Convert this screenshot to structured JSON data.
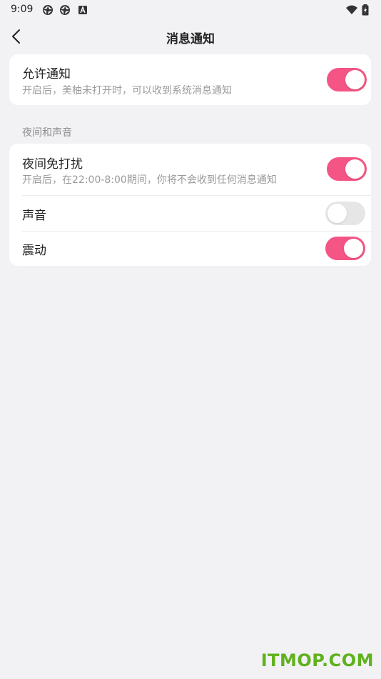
{
  "status_bar": {
    "time": "9:09",
    "icons": [
      "aperture-icon",
      "aperture-icon",
      "keyboard-a-icon",
      "wifi-icon",
      "battery-charging-icon"
    ]
  },
  "header": {
    "title": "消息通知",
    "back_icon": "chevron-left-icon"
  },
  "allow_notifications": {
    "title": "允许通知",
    "description": "开启后，美柚未打开时，可以收到系统消息通知",
    "enabled": true
  },
  "night_section": {
    "header": "夜间和声音",
    "items": [
      {
        "title": "夜间免打扰",
        "description": "开启后，在22:00-8:00期间，你将不会收到任何消息通知",
        "enabled": true
      },
      {
        "title": "声音",
        "enabled": false
      },
      {
        "title": "震动",
        "enabled": true
      }
    ]
  },
  "colors": {
    "accent": "#f45584",
    "background": "#f2f2f5",
    "card": "#ffffff",
    "toggle_off": "#e6e6e6"
  },
  "watermark": "ITMOP.COM"
}
